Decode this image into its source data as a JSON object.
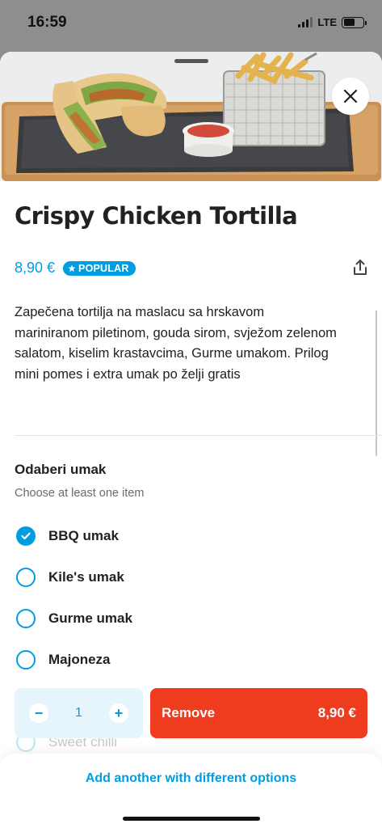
{
  "status_bar": {
    "time": "16:59",
    "network": "LTE",
    "battery_level": 0.6
  },
  "product": {
    "name": "Crispy Chicken Tortilla",
    "price": "8,90 €",
    "badge": "POPULAR",
    "description": "Zapečena tortilja na maslacu sa hrskavom mariniranom piletinom, gouda sirom, svježom zelenom salatom, kiselim krastavcima, Gurme umakom. Prilog mini pomes i extra umak po želji gratis"
  },
  "options_group": {
    "title": "Odaberi umak",
    "subtitle": "Choose at least one item",
    "items": [
      {
        "label": "BBQ umak",
        "checked": true
      },
      {
        "label": "Kile's umak",
        "checked": false
      },
      {
        "label": "Gurme umak",
        "checked": false
      },
      {
        "label": "Majoneza",
        "checked": false
      },
      {
        "label": "Sweet chilli",
        "checked": false
      }
    ]
  },
  "action_bar": {
    "quantity": "1",
    "minus": "−",
    "plus": "+",
    "remove_label": "Remove",
    "total": "8,90 €"
  },
  "footer": {
    "add_another_label": "Add another with different options"
  },
  "colors": {
    "accent": "#009de0",
    "remove": "#f03c1e",
    "text": "#202125"
  },
  "icons": {
    "close": "close-icon",
    "share": "share-icon",
    "star": "star-icon",
    "check": "check-icon"
  }
}
